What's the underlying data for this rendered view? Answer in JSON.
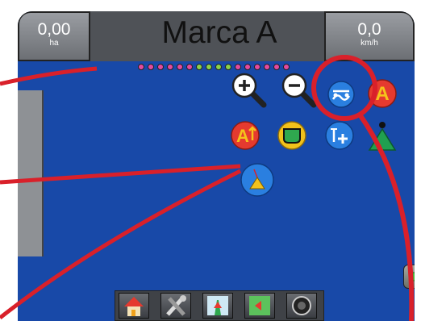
{
  "header": {
    "area_value": "0,00",
    "area_unit": "ha",
    "title": "Marca A",
    "speed_value": "0,0",
    "speed_unit": "km/h"
  },
  "boom_sections": {
    "count": 16,
    "colors": [
      "#e24aa0",
      "#e24aa0",
      "#e24aa0",
      "#e24aa0",
      "#e24aa0",
      "#e24aa0",
      "#8bd14a",
      "#8bd14a",
      "#8bd14a",
      "#8bd14a",
      "#e24aa0",
      "#e24aa0",
      "#e24aa0",
      "#e24aa0",
      "#e24aa0",
      "#e24aa0"
    ]
  },
  "toolbar_icons": [
    "zoom-in-icon",
    "zoom-out-icon",
    "guidance-mode-icon",
    "mark-a-icon",
    "mark-a-plus-icon",
    "boundary-icon",
    "add-point-icon",
    "vehicle-icon"
  ],
  "bottom_nav": [
    "home-icon",
    "tools-icon",
    "guidance-screen-icon",
    "map-screen-icon",
    "camera-icon"
  ],
  "colors": {
    "screen_bg": "#1849a8",
    "annotation_red": "#d9202a",
    "mark_red": "#e53a2f",
    "highlight_blue": "#2a7fe0",
    "boundary_yellow": "#f2c21b",
    "vehicle_green": "#20a050"
  }
}
